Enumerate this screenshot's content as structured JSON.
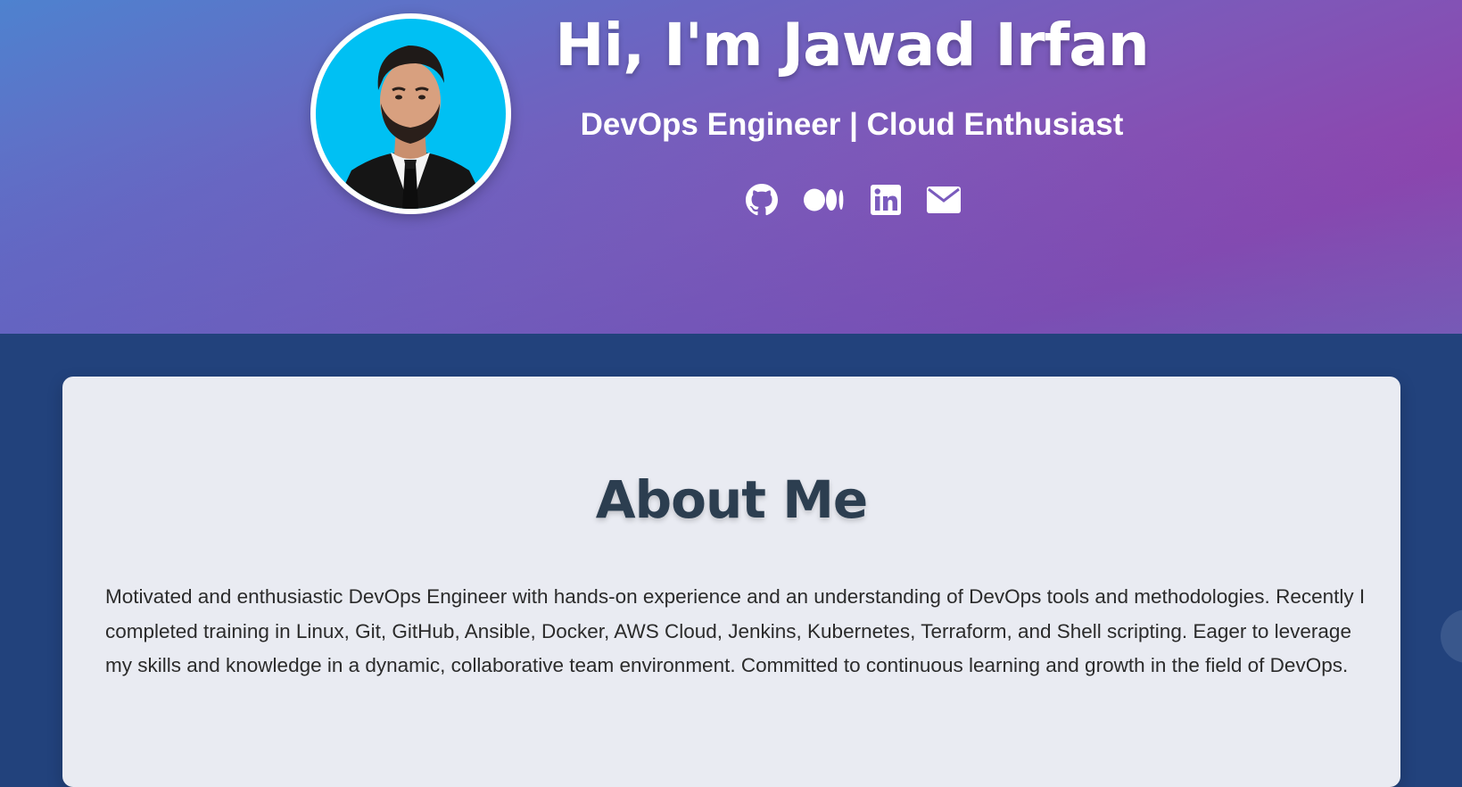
{
  "hero": {
    "title": "Hi, I'm Jawad Irfan",
    "subtitle": "DevOps Engineer | Cloud Enthusiast",
    "avatar_alt": "Jawad Irfan",
    "socials": [
      {
        "name": "GitHub",
        "icon": "github-icon"
      },
      {
        "name": "Medium",
        "icon": "medium-icon"
      },
      {
        "name": "LinkedIn",
        "icon": "linkedin-icon"
      },
      {
        "name": "Email",
        "icon": "envelope-icon"
      }
    ]
  },
  "about": {
    "heading": "About Me",
    "text": "Motivated and enthusiastic DevOps Engineer with hands-on experience and an understanding of DevOps tools and methodologies. Recently I completed training in Linux, Git, GitHub, Ansible, Docker, AWS Cloud, Jenkins, Kubernetes, Terraform, and Shell scripting. Eager to leverage my skills and knowledge in a dynamic, collaborative team environment. Committed to continuous learning and growth in the field of DevOps."
  },
  "colors": {
    "hero_gradient_start": "#4e82cf",
    "hero_gradient_end": "#8e44ad",
    "page_background": "#22427c",
    "card_background": "#e9ebf2",
    "heading_color": "#2c3e50",
    "avatar_background": "#00c0f3"
  }
}
